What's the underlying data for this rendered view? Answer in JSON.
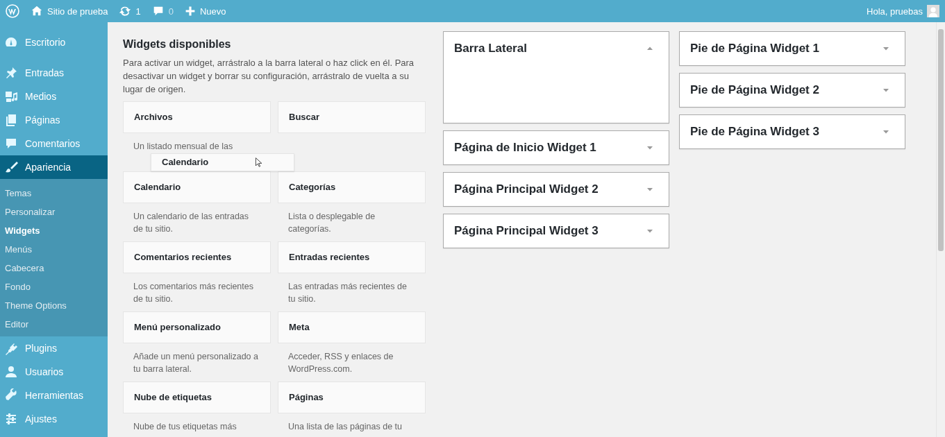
{
  "admin_bar": {
    "site_name": "Sitio de prueba",
    "updates": "1",
    "comments": "0",
    "new_label": "Nuevo",
    "greeting": "Hola, pruebas"
  },
  "menu": [
    {
      "label": "Escritorio",
      "selected": false
    },
    {
      "label": "Entradas",
      "selected": false
    },
    {
      "label": "Medios",
      "selected": false
    },
    {
      "label": "Páginas",
      "selected": false
    },
    {
      "label": "Comentarios",
      "selected": false
    },
    {
      "label": "Apariencia",
      "selected": true,
      "children": [
        {
          "label": "Temas",
          "selected": false
        },
        {
          "label": "Personalizar",
          "selected": false
        },
        {
          "label": "Widgets",
          "selected": true
        },
        {
          "label": "Menús",
          "selected": false
        },
        {
          "label": "Cabecera",
          "selected": false
        },
        {
          "label": "Fondo",
          "selected": false
        },
        {
          "label": "Theme Options",
          "selected": false
        },
        {
          "label": "Editor",
          "selected": false
        }
      ]
    },
    {
      "label": "Plugins",
      "selected": false
    },
    {
      "label": "Usuarios",
      "selected": false
    },
    {
      "label": "Herramientas",
      "selected": false
    },
    {
      "label": "Ajustes",
      "selected": false
    }
  ],
  "widgets_panel": {
    "title": "Widgets disponibles",
    "description": "Para activar un widget, arrástralo a la barra lateral o haz click en él. Para desactivar un widget y borrar su configuración, arrástralo de vuelta a su lugar de origen.",
    "widgets": [
      {
        "title": "Archivos",
        "description": "Un listado mensual de las"
      },
      {
        "title": "Buscar"
      },
      {
        "title": "Calendario",
        "description": "Un calendario de las entradas de tu sitio."
      },
      {
        "title": "Categorías",
        "description": "Lista o desplegable de categorías."
      },
      {
        "title": "Comentarios recientes",
        "description": "Los comentarios más recientes de tu sitio."
      },
      {
        "title": "Entradas recientes",
        "description": "Las entradas más recientes de tu sitio."
      },
      {
        "title": "Menú personalizado",
        "description": "Añade un menú personalizado a tu barra lateral."
      },
      {
        "title": "Meta",
        "description": "Acceder, RSS y enlaces de WordPress.com."
      },
      {
        "title": "Nube de etiquetas",
        "description": "Nube de tus etiquetas más"
      },
      {
        "title": "Páginas",
        "description": "Una lista de las páginas de tu"
      }
    ]
  },
  "sidebar_columns": [
    [
      {
        "title": "Barra Lateral",
        "expanded": true
      },
      {
        "title": "Página de Inicio Widget 1",
        "expanded": false
      },
      {
        "title": "Página Principal Widget 2",
        "expanded": false
      },
      {
        "title": "Página Principal Widget 3",
        "expanded": false
      }
    ],
    [
      {
        "title": "Pie de Página Widget 1",
        "expanded": false
      },
      {
        "title": "Pie de Página Widget 2",
        "expanded": false
      },
      {
        "title": "Pie de Página Widget 3",
        "expanded": false
      }
    ]
  ],
  "drag_helper": {
    "title": "Calendario"
  }
}
